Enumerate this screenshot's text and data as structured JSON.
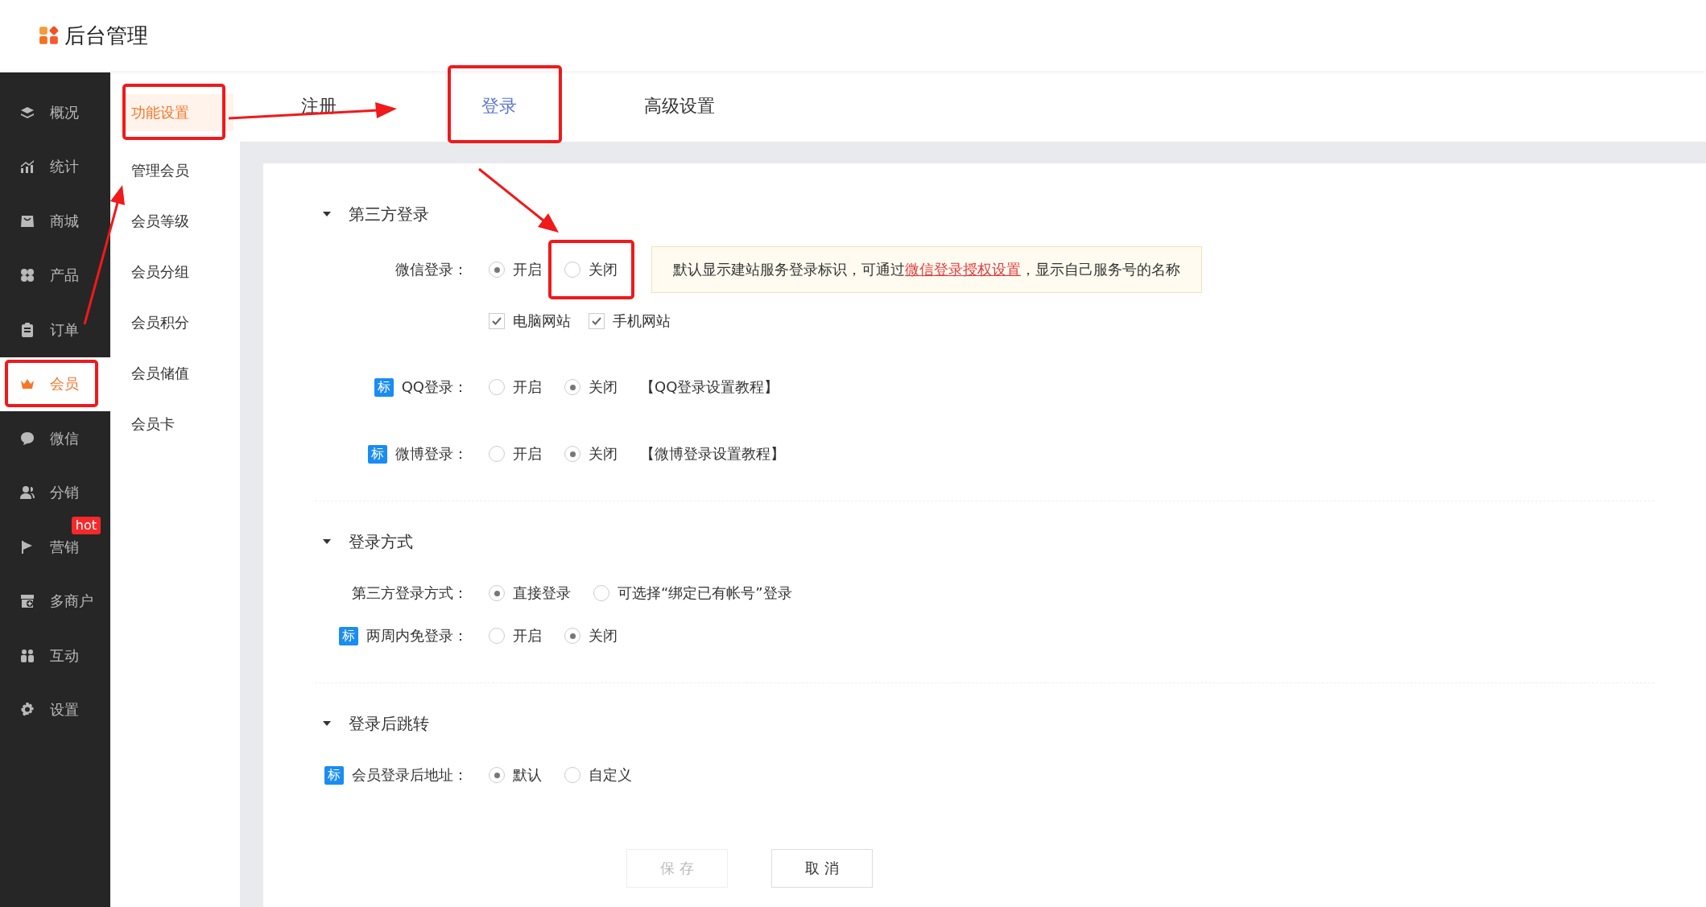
{
  "header": {
    "title": "后台管理"
  },
  "nav": [
    {
      "label": "概况",
      "selected": false
    },
    {
      "label": "统计",
      "selected": false
    },
    {
      "label": "商城",
      "selected": false
    },
    {
      "label": "产品",
      "selected": false
    },
    {
      "label": "订单",
      "selected": false
    },
    {
      "label": "会员",
      "selected": true
    },
    {
      "label": "微信",
      "selected": false
    },
    {
      "label": "分销",
      "selected": false
    },
    {
      "label": "营销",
      "selected": false,
      "badge": "hot"
    },
    {
      "label": "多商户",
      "selected": false
    },
    {
      "label": "互动",
      "selected": false
    },
    {
      "label": "设置",
      "selected": false
    }
  ],
  "subnav": [
    {
      "label": "功能设置",
      "selected": true
    },
    {
      "label": "管理会员",
      "selected": false
    },
    {
      "label": "会员等级",
      "selected": false
    },
    {
      "label": "会员分组",
      "selected": false
    },
    {
      "label": "会员积分",
      "selected": false
    },
    {
      "label": "会员储值",
      "selected": false
    },
    {
      "label": "会员卡",
      "selected": false
    }
  ],
  "tabs": [
    {
      "label": "注册",
      "selected": false
    },
    {
      "label": "登录",
      "selected": true
    },
    {
      "label": "高级设置",
      "selected": false
    }
  ],
  "sections": [
    {
      "title": "第三方登录",
      "rows": [
        {
          "label": "微信登录：",
          "options": [
            {
              "label": "开启",
              "selected": true
            },
            {
              "label": "关闭",
              "selected": false
            }
          ],
          "notice": {
            "before": "默认显示建站服务登录标识，可通过",
            "link": "微信登录授权设置",
            "after": "，显示自己服务号的名称"
          },
          "checkboxes": [
            {
              "label": "电脑网站",
              "checked": true
            },
            {
              "label": "手机网站",
              "checked": true
            }
          ]
        },
        {
          "tag": "标",
          "label": "QQ登录：",
          "options": [
            {
              "label": "开启",
              "selected": false
            },
            {
              "label": "关闭",
              "selected": true
            }
          ],
          "help": "【QQ登录设置教程】"
        },
        {
          "tag": "标",
          "label": "微博登录：",
          "options": [
            {
              "label": "开启",
              "selected": false
            },
            {
              "label": "关闭",
              "selected": true
            }
          ],
          "help": "【微博登录设置教程】"
        }
      ]
    },
    {
      "title": "登录方式",
      "rows": [
        {
          "label": "第三方登录方式：",
          "options": [
            {
              "label": "直接登录",
              "selected": true
            },
            {
              "label": "可选择“绑定已有帐号”登录",
              "selected": false
            }
          ]
        },
        {
          "tag": "标",
          "label": "两周内免登录：",
          "options": [
            {
              "label": "开启",
              "selected": false
            },
            {
              "label": "关闭",
              "selected": true
            }
          ]
        }
      ]
    },
    {
      "title": "登录后跳转",
      "rows": [
        {
          "tag": "标",
          "label": "会员登录后地址：",
          "options": [
            {
              "label": "默认",
              "selected": true
            },
            {
              "label": "自定义",
              "selected": false
            }
          ]
        }
      ]
    }
  ],
  "buttons": [
    {
      "label": "保 存",
      "disabled": true
    },
    {
      "label": "取 消",
      "disabled": false
    }
  ]
}
